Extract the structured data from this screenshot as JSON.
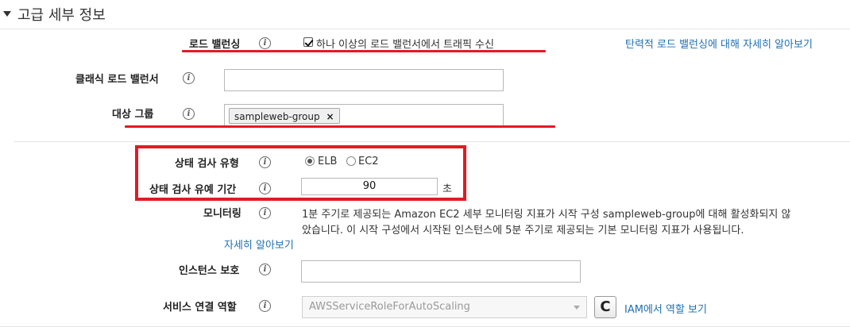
{
  "section": {
    "title": "고급 세부 정보"
  },
  "load_balancing": {
    "label": "로드 밸런싱",
    "checkbox_label": "하나 이상의 로드 밸런서에서 트래픽 수신",
    "checked": true,
    "learn_more_link": "탄력적 로드 밸런싱에 대해 자세히 알아보기"
  },
  "classic_lb": {
    "label": "클래식 로드 밸런서",
    "value": ""
  },
  "target_group": {
    "label": "대상 그룹",
    "tags": [
      "sampleweb-group"
    ],
    "remove_glyph": "×"
  },
  "health_check_type": {
    "label": "상태 검사 유형",
    "options": [
      {
        "label": "ELB",
        "checked": true
      },
      {
        "label": "EC2",
        "checked": false
      }
    ]
  },
  "health_check_grace": {
    "label": "상태 검사 유예 기간",
    "value": "90",
    "unit": "초"
  },
  "monitoring": {
    "label": "모니터링",
    "line1": "1분 주기로 제공되는 Amazon EC2 세부 모니터링 지표가 시작 구성 sampleweb-group에 대해 활성화되지 않",
    "line2": "았습니다. 이 시작 구성에서 시작된 인스턴스에 5분 주기로 제공되는 기본 모니터링 지표가 사용됩니다.",
    "learn_more_link": "자세히 알아보기"
  },
  "instance_protection": {
    "label": "인스턴스 보호",
    "value": ""
  },
  "service_linked_role": {
    "label": "서비스 연결 역할",
    "selected": "AWSServiceRoleForAutoScaling",
    "refresh_glyph": "C",
    "iam_link": "IAM에서 역할 보기"
  },
  "info_glyph": "i",
  "annotation_color": "#e21b24"
}
